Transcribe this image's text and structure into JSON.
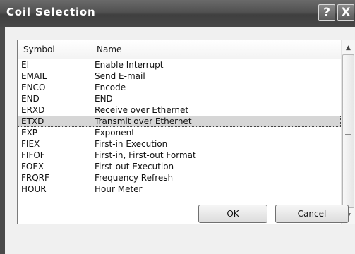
{
  "window": {
    "title": "Coil Selection",
    "help_label": "?",
    "close_label": "X"
  },
  "list": {
    "columns": [
      "Symbol",
      "Name"
    ],
    "selected_index": 5,
    "rows": [
      {
        "symbol": "EI",
        "name": "Enable Interrupt"
      },
      {
        "symbol": "EMAIL",
        "name": "Send E-mail"
      },
      {
        "symbol": "ENCO",
        "name": "Encode"
      },
      {
        "symbol": "END",
        "name": "END"
      },
      {
        "symbol": "ERXD",
        "name": "Receive over Ethernet"
      },
      {
        "symbol": "ETXD",
        "name": "Transmit over Ethernet"
      },
      {
        "symbol": "EXP",
        "name": "Exponent"
      },
      {
        "symbol": "FIEX",
        "name": "First-in Execution"
      },
      {
        "symbol": "FIFOF",
        "name": "First-in, First-out Format"
      },
      {
        "symbol": "FOEX",
        "name": "First-out Execution"
      },
      {
        "symbol": "FRQRF",
        "name": "Frequency Refresh"
      },
      {
        "symbol": "HOUR",
        "name": "Hour Meter"
      }
    ]
  },
  "buttons": {
    "ok_label": "OK",
    "cancel_label": "Cancel"
  },
  "icons": {
    "scroll_up": "scroll-up-arrow-icon",
    "scroll_down": "scroll-down-arrow-icon",
    "grip": "scroll-grip-icon"
  }
}
